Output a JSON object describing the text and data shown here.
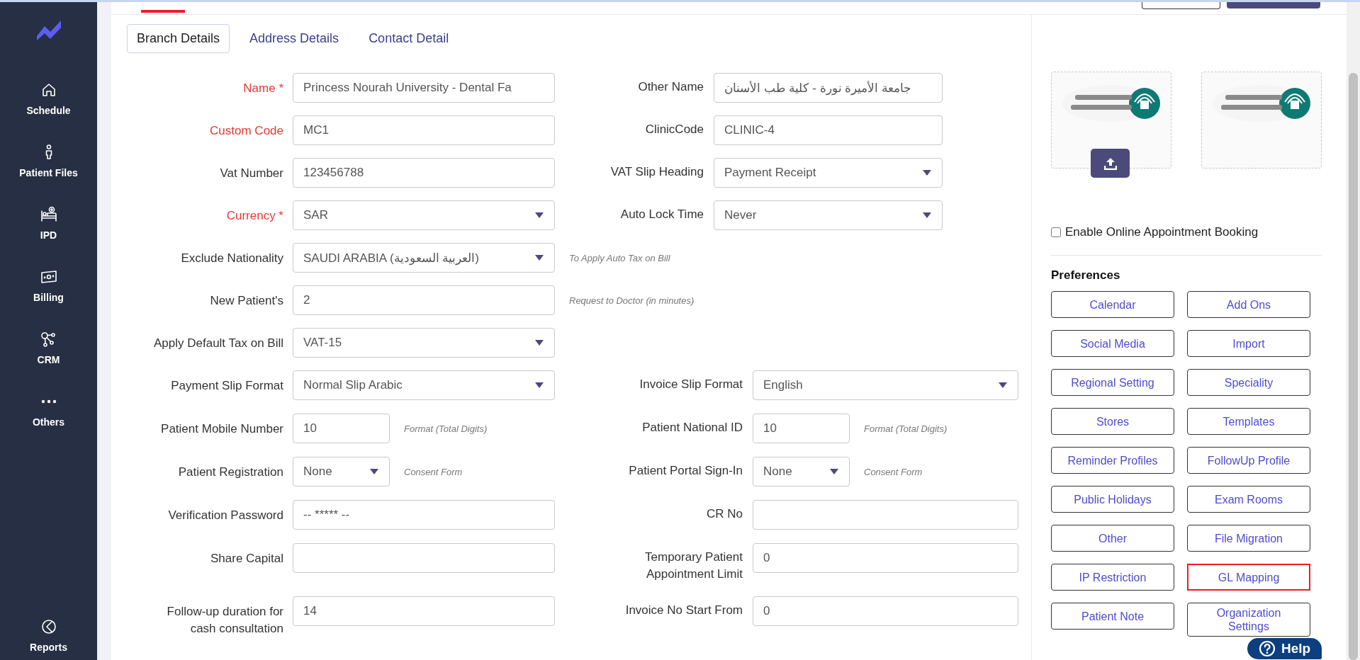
{
  "sidebar": {
    "items": [
      {
        "label": "Schedule"
      },
      {
        "label": "Patient Files"
      },
      {
        "label": "IPD"
      },
      {
        "label": "Billing"
      },
      {
        "label": "CRM"
      },
      {
        "label": "Others"
      }
    ],
    "footer_items": [
      {
        "label": "Reports"
      }
    ]
  },
  "tabs": [
    {
      "label": "Branch Details",
      "selected": true
    },
    {
      "label": "Address Details",
      "selected": false
    },
    {
      "label": "Contact Detail",
      "selected": false
    }
  ],
  "form": {
    "sections": [
      {
        "rows": [
          {
            "left": {
              "label": "Name *",
              "required": true,
              "kind": "text",
              "value": "Princess Nourah University - Dental Fa"
            },
            "right": {
              "label": "Other Name",
              "required": false,
              "kind": "text",
              "value": "جامعة الأميرة نورة - كلية طب الأسنان"
            }
          },
          {
            "left": {
              "label": "Custom Code",
              "required": true,
              "kind": "text",
              "value": "MC1"
            },
            "right": {
              "label": "ClinicCode",
              "required": false,
              "kind": "text",
              "value": "CLINIC-4"
            }
          },
          {
            "left": {
              "label": "Vat Number",
              "required": false,
              "kind": "text",
              "value": "123456788"
            },
            "right": {
              "label": "VAT Slip Heading",
              "required": false,
              "kind": "select",
              "value": "Payment Receipt"
            }
          },
          {
            "left": {
              "label": "Currency *",
              "required": true,
              "kind": "select",
              "value": "SAR"
            },
            "right": {
              "label": "Auto Lock Time",
              "required": false,
              "kind": "select",
              "value": "Never"
            }
          },
          {
            "left": {
              "label": "Exclude Nationality",
              "required": false,
              "kind": "select",
              "value": "SAUDI ARABIA (العربية السعودية)",
              "hint": "To Apply Auto Tax on Bill"
            }
          },
          {
            "left": {
              "label": "New Patient's",
              "required": false,
              "kind": "text",
              "value": "2",
              "hint": "Request to Doctor (in minutes)"
            }
          },
          {
            "left": {
              "label": "Apply Default Tax on Bill",
              "required": false,
              "kind": "select",
              "value": "VAT-15"
            }
          }
        ]
      },
      {
        "rows": [
          {
            "left": {
              "label": "Payment Slip Format",
              "required": false,
              "kind": "select",
              "value": "Normal Slip Arabic"
            },
            "right": {
              "label": "Invoice Slip Format",
              "required": false,
              "kind": "select",
              "value": "English"
            }
          },
          {
            "left": {
              "label": "Patient Mobile Number",
              "required": false,
              "kind": "short-text",
              "value": "10",
              "hint": "Format (Total Digits)"
            },
            "right": {
              "label": "Patient National ID",
              "required": false,
              "kind": "short-text",
              "value": "10",
              "hint": "Format (Total Digits)"
            }
          },
          {
            "left": {
              "label": "Patient Registration",
              "required": false,
              "kind": "short-select",
              "value": "None",
              "hint": "Consent Form"
            },
            "right": {
              "label": "Patient Portal Sign-In",
              "required": false,
              "kind": "short-select",
              "value": "None",
              "hint": "Consent Form"
            }
          },
          {
            "left": {
              "label": "Verification Password",
              "required": false,
              "kind": "text",
              "value": "-- ***** --"
            },
            "right": {
              "label": "CR No",
              "required": false,
              "kind": "text"
            }
          },
          {
            "left": {
              "label": "Share Capital",
              "required": false,
              "kind": "text"
            },
            "right": {
              "label": "Temporary Patient Appointment Limit",
              "required": false,
              "kind": "text",
              "value": "0"
            }
          },
          {
            "left": {
              "label": "Follow-up duration for cash consultation",
              "required": false,
              "kind": "text",
              "value": "14"
            },
            "right": {
              "label": "Invoice No Start From",
              "required": false,
              "kind": "text",
              "value": "0"
            }
          }
        ]
      }
    ]
  },
  "logos": [
    {
      "upload_button": true
    },
    {
      "upload_button": false
    }
  ],
  "online_booking": {
    "label": "Enable Online Appointment Booking",
    "checked": false
  },
  "preferences": {
    "title": "Preferences",
    "buttons": [
      {
        "label": "Calendar",
        "highlighted": false
      },
      {
        "label": "Add Ons",
        "highlighted": false
      },
      {
        "label": "Social Media",
        "highlighted": false
      },
      {
        "label": "Import",
        "highlighted": false
      },
      {
        "label": "Regional Setting",
        "highlighted": false
      },
      {
        "label": "Speciality",
        "highlighted": false
      },
      {
        "label": "Stores",
        "highlighted": false
      },
      {
        "label": "Templates",
        "highlighted": false
      },
      {
        "label": "Reminder Profiles",
        "highlighted": false
      },
      {
        "label": "FollowUp Profile",
        "highlighted": false
      },
      {
        "label": "Public Holidays",
        "highlighted": false
      },
      {
        "label": "Exam Rooms",
        "highlighted": false
      },
      {
        "label": "Other",
        "highlighted": false
      },
      {
        "label": "File Migration",
        "highlighted": false
      },
      {
        "label": "IP Restriction",
        "highlighted": false
      },
      {
        "label": "GL Mapping",
        "highlighted": true
      },
      {
        "label": "Patient Note",
        "highlighted": false
      },
      {
        "label": "Organization Settings",
        "highlighted": false
      }
    ]
  },
  "help": {
    "label": "Help"
  }
}
